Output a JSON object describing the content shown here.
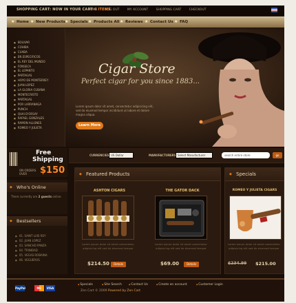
{
  "topbar": {
    "shipping_text": "SHOPPING CART: NOW IN YOUR CART",
    "shipping_amount": "0 ITEMS",
    "links": [
      "HOME",
      "LOG OUT",
      "MY ACCOUNT",
      "SHOPPING CART",
      "CHECKOUT"
    ]
  },
  "nav": {
    "items": [
      "Home",
      "New Products",
      "Specials",
      "Products All",
      "Reviews",
      "Contact Us",
      "FAQ"
    ]
  },
  "categories": [
    "BOLIVAR",
    "COHIBA",
    "CUABA",
    "EN ESPECIFICOS",
    "EL REY DEL MUNDO",
    "FONSECA",
    "EL LEPANTO",
    "PARTAGAS",
    "HOYO DE MONTERREY",
    "JUAN LOPEZ",
    "LA GLORIA CUBANA",
    "MONTECRISTO",
    "PARTAGAS",
    "POR LARRANAGA",
    "PUNCH",
    "QUAI D'ORSAY",
    "RAFAEL GONZALES",
    "RAMON ALLONES",
    "ROMEO Y JULIETA"
  ],
  "hero": {
    "brand": "Cigar Store",
    "tagline": "Perfect cigar for you since 1883...",
    "body": "Lorem ipsum dolor sit amet, consectetur adipisicing elit, sed do eiusmod tempor incididunt ut labore et dolore magna aliqua.",
    "cta": "Learn More"
  },
  "freeship": {
    "line1": "Free",
    "line2": "Shipping",
    "line3": "ON ORDERS OVER",
    "amount": "$150"
  },
  "toolbar": {
    "currencies_label": "CURRENCIES:",
    "currency_value": "US Dollar",
    "manufacturers_label": "MANUFACTURERS:",
    "manufacturer_value": "Select Manufacturer",
    "search_placeholder": "search entire store",
    "go_label": "go"
  },
  "whos_online": {
    "title": "Who's Online",
    "text_prefix": "There currently are",
    "guests": "2 guests",
    "text_suffix": "online."
  },
  "bestsellers": {
    "title": "Bestsellers",
    "items": [
      "01. SAINT LUIS REY",
      "02. JUAN LOPEZ",
      "03. SANCHO PANZA",
      "04. TRINIDAD",
      "05. VEGAS ROBAINA",
      "06. VEGUEROS"
    ]
  },
  "featured": {
    "title": "Featured Products",
    "products": [
      {
        "name": "ASHTON CIGARS",
        "desc": "Lorem ipsum dolor sit amet consectetur adipisicing elit sed do eiusmod tempor",
        "price": "$214.50",
        "details": "Details"
      },
      {
        "name": "THE GATOR DACK",
        "desc": "Lorem ipsum dolor sit amet consectetur adipisicing elit sed do eiusmod tempor",
        "price": "$69.00",
        "details": "Details"
      }
    ]
  },
  "specials": {
    "title": "Specials",
    "product": {
      "name": "ROMEO Y JULIETA CIGARS",
      "desc": "Lorem ipsum dolor sit amet consectetur adipisicing elit sed do eiusmod tempor",
      "old_price": "$234.99",
      "price": "$215.00"
    }
  },
  "footer": {
    "cards": [
      "PayPal",
      "MC",
      "VISA"
    ],
    "links": [
      "Specials",
      "Site Search",
      "Contact Us",
      "Create an account",
      "Customer Login"
    ],
    "copyright": "Zen Cart © 2009",
    "powered": "Powered by Zen Cart"
  },
  "colors": {
    "accent": "#e07a1a",
    "bg": "#1a0e08",
    "nav": "#c9b48a"
  }
}
